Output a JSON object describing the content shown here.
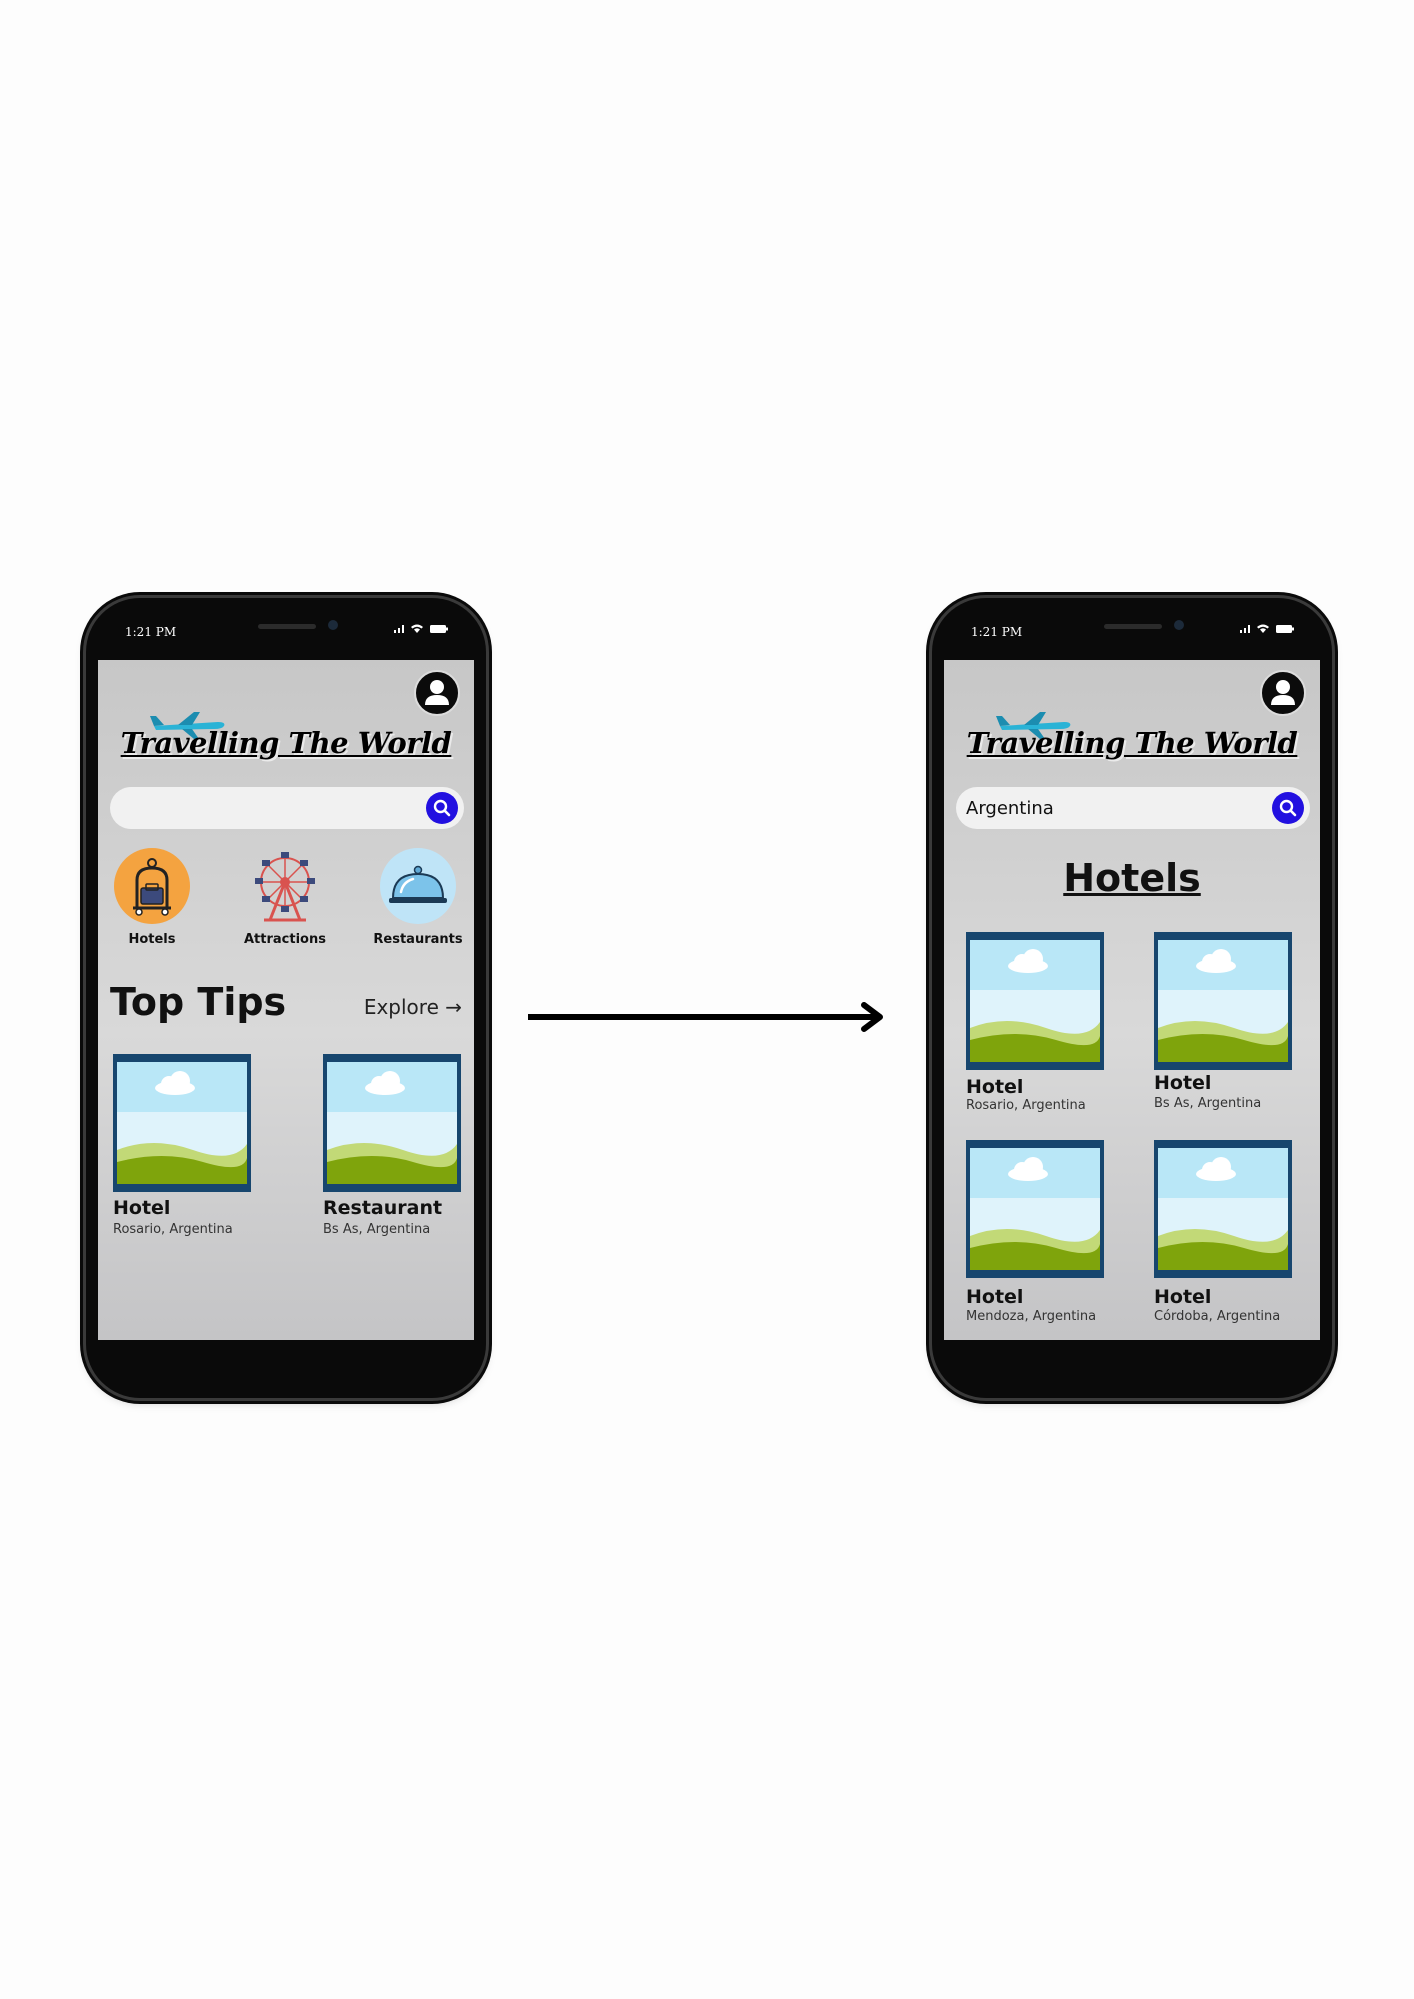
{
  "screens": [
    {
      "status": {
        "time": "1:21 PM"
      },
      "app_title": "Travelling The World",
      "search": {
        "value": ""
      },
      "categories": [
        {
          "label": "Hotels",
          "icon": "hotel-bell-icon"
        },
        {
          "label": "Attractions",
          "icon": "ferris-wheel-icon"
        },
        {
          "label": "Restaurants",
          "icon": "food-cloche-icon"
        }
      ],
      "top_tips": {
        "title": "Top Tips",
        "explore": "Explore →",
        "cards": [
          {
            "title": "Hotel",
            "location": "Rosario, Argentina"
          },
          {
            "title": "Restaurant",
            "location": "Bs As, Argentina"
          }
        ]
      }
    },
    {
      "status": {
        "time": "1:21 PM"
      },
      "app_title": "Travelling The World",
      "search": {
        "value": "Argentina"
      },
      "section_title": "Hotels",
      "results": [
        {
          "title": "Hotel",
          "location": "Rosario, Argentina"
        },
        {
          "title": "Hotel",
          "location": "Bs As, Argentina"
        },
        {
          "title": "Hotel",
          "location": "Mendoza, Argentina"
        },
        {
          "title": "Hotel",
          "location": "Córdoba, Argentina"
        }
      ]
    }
  ],
  "colors": {
    "search_accent": "#2210e0",
    "hotel_icon_bg": "#f4a340",
    "restaurant_icon_bg": "#bfe4f7",
    "plane": "#2ab3d6"
  }
}
